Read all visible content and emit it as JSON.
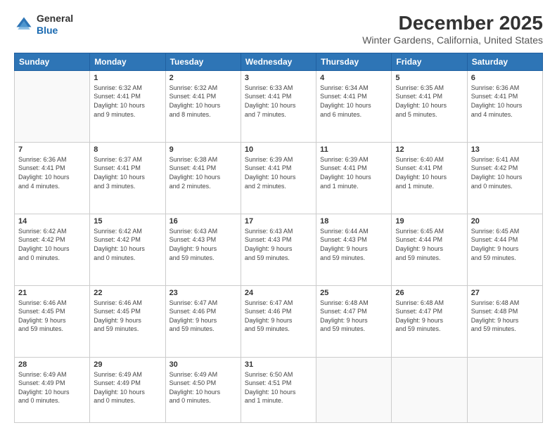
{
  "logo": {
    "general": "General",
    "blue": "Blue"
  },
  "title": "December 2025",
  "subtitle": "Winter Gardens, California, United States",
  "days_of_week": [
    "Sunday",
    "Monday",
    "Tuesday",
    "Wednesday",
    "Thursday",
    "Friday",
    "Saturday"
  ],
  "weeks": [
    [
      {
        "num": "",
        "info": ""
      },
      {
        "num": "1",
        "info": "Sunrise: 6:32 AM\nSunset: 4:41 PM\nDaylight: 10 hours\nand 9 minutes."
      },
      {
        "num": "2",
        "info": "Sunrise: 6:32 AM\nSunset: 4:41 PM\nDaylight: 10 hours\nand 8 minutes."
      },
      {
        "num": "3",
        "info": "Sunrise: 6:33 AM\nSunset: 4:41 PM\nDaylight: 10 hours\nand 7 minutes."
      },
      {
        "num": "4",
        "info": "Sunrise: 6:34 AM\nSunset: 4:41 PM\nDaylight: 10 hours\nand 6 minutes."
      },
      {
        "num": "5",
        "info": "Sunrise: 6:35 AM\nSunset: 4:41 PM\nDaylight: 10 hours\nand 5 minutes."
      },
      {
        "num": "6",
        "info": "Sunrise: 6:36 AM\nSunset: 4:41 PM\nDaylight: 10 hours\nand 4 minutes."
      }
    ],
    [
      {
        "num": "7",
        "info": "Sunrise: 6:36 AM\nSunset: 4:41 PM\nDaylight: 10 hours\nand 4 minutes."
      },
      {
        "num": "8",
        "info": "Sunrise: 6:37 AM\nSunset: 4:41 PM\nDaylight: 10 hours\nand 3 minutes."
      },
      {
        "num": "9",
        "info": "Sunrise: 6:38 AM\nSunset: 4:41 PM\nDaylight: 10 hours\nand 2 minutes."
      },
      {
        "num": "10",
        "info": "Sunrise: 6:39 AM\nSunset: 4:41 PM\nDaylight: 10 hours\nand 2 minutes."
      },
      {
        "num": "11",
        "info": "Sunrise: 6:39 AM\nSunset: 4:41 PM\nDaylight: 10 hours\nand 1 minute."
      },
      {
        "num": "12",
        "info": "Sunrise: 6:40 AM\nSunset: 4:41 PM\nDaylight: 10 hours\nand 1 minute."
      },
      {
        "num": "13",
        "info": "Sunrise: 6:41 AM\nSunset: 4:42 PM\nDaylight: 10 hours\nand 0 minutes."
      }
    ],
    [
      {
        "num": "14",
        "info": "Sunrise: 6:42 AM\nSunset: 4:42 PM\nDaylight: 10 hours\nand 0 minutes."
      },
      {
        "num": "15",
        "info": "Sunrise: 6:42 AM\nSunset: 4:42 PM\nDaylight: 10 hours\nand 0 minutes."
      },
      {
        "num": "16",
        "info": "Sunrise: 6:43 AM\nSunset: 4:43 PM\nDaylight: 9 hours\nand 59 minutes."
      },
      {
        "num": "17",
        "info": "Sunrise: 6:43 AM\nSunset: 4:43 PM\nDaylight: 9 hours\nand 59 minutes."
      },
      {
        "num": "18",
        "info": "Sunrise: 6:44 AM\nSunset: 4:43 PM\nDaylight: 9 hours\nand 59 minutes."
      },
      {
        "num": "19",
        "info": "Sunrise: 6:45 AM\nSunset: 4:44 PM\nDaylight: 9 hours\nand 59 minutes."
      },
      {
        "num": "20",
        "info": "Sunrise: 6:45 AM\nSunset: 4:44 PM\nDaylight: 9 hours\nand 59 minutes."
      }
    ],
    [
      {
        "num": "21",
        "info": "Sunrise: 6:46 AM\nSunset: 4:45 PM\nDaylight: 9 hours\nand 59 minutes."
      },
      {
        "num": "22",
        "info": "Sunrise: 6:46 AM\nSunset: 4:45 PM\nDaylight: 9 hours\nand 59 minutes."
      },
      {
        "num": "23",
        "info": "Sunrise: 6:47 AM\nSunset: 4:46 PM\nDaylight: 9 hours\nand 59 minutes."
      },
      {
        "num": "24",
        "info": "Sunrise: 6:47 AM\nSunset: 4:46 PM\nDaylight: 9 hours\nand 59 minutes."
      },
      {
        "num": "25",
        "info": "Sunrise: 6:48 AM\nSunset: 4:47 PM\nDaylight: 9 hours\nand 59 minutes."
      },
      {
        "num": "26",
        "info": "Sunrise: 6:48 AM\nSunset: 4:47 PM\nDaylight: 9 hours\nand 59 minutes."
      },
      {
        "num": "27",
        "info": "Sunrise: 6:48 AM\nSunset: 4:48 PM\nDaylight: 9 hours\nand 59 minutes."
      }
    ],
    [
      {
        "num": "28",
        "info": "Sunrise: 6:49 AM\nSunset: 4:49 PM\nDaylight: 10 hours\nand 0 minutes."
      },
      {
        "num": "29",
        "info": "Sunrise: 6:49 AM\nSunset: 4:49 PM\nDaylight: 10 hours\nand 0 minutes."
      },
      {
        "num": "30",
        "info": "Sunrise: 6:49 AM\nSunset: 4:50 PM\nDaylight: 10 hours\nand 0 minutes."
      },
      {
        "num": "31",
        "info": "Sunrise: 6:50 AM\nSunset: 4:51 PM\nDaylight: 10 hours\nand 1 minute."
      },
      {
        "num": "",
        "info": ""
      },
      {
        "num": "",
        "info": ""
      },
      {
        "num": "",
        "info": ""
      }
    ]
  ]
}
